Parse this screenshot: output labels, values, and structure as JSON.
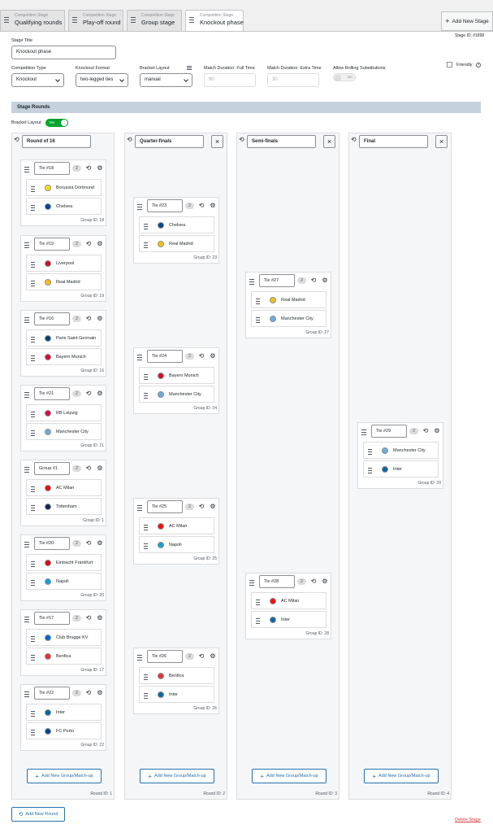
{
  "tabs": [
    {
      "sub": "Competition Stage",
      "label": "Qualifying rounds"
    },
    {
      "sub": "Competition Stage",
      "label": "Play-off round"
    },
    {
      "sub": "Competition Stage",
      "label": "Group stage"
    },
    {
      "sub": "Competition Stage",
      "label": "Knockout phase"
    }
  ],
  "add_stage_label": "Add New Stage",
  "stage_id": "Stage ID: #1898",
  "stage_title": {
    "label": "Stage Title",
    "value": "Knockout phase"
  },
  "friendly_label": "Friendly",
  "fields": {
    "competition_type": {
      "label": "Competition Type",
      "value": "Knockout"
    },
    "knockout_format": {
      "label": "Knockout Format",
      "value": "two-legged ties"
    },
    "bracket_layout": {
      "label": "Bracket Layout",
      "value": "manual"
    },
    "duration_full": {
      "label": "Match Duration: Full Time",
      "placeholder": "90"
    },
    "duration_extra": {
      "label": "Match Duration: Extra Time",
      "placeholder": "30"
    },
    "rolling_subs": {
      "label": "Allow Rolling Substitutions",
      "toggle": "No"
    }
  },
  "section_title": "Stage Rounds",
  "bracket_layout_toggle": {
    "label": "Bracket Layout",
    "toggle": "Yes"
  },
  "add_group_label": "Add New Group/Match-up",
  "add_round_label": "Add New Round",
  "delete_stage_label": "Delete Stage",
  "rounds": [
    {
      "name": "Round of 16",
      "round_id": "Round ID: 1",
      "groups": [
        {
          "tie": "Tie #18",
          "count": "2",
          "team1": "Borussia Dortmund",
          "team2": "Chelsea",
          "group_id": "Group ID: 18"
        },
        {
          "tie": "Tie #19",
          "count": "2",
          "team1": "Liverpool",
          "team2": "Real Madrid",
          "group_id": "Group ID: 19"
        },
        {
          "tie": "Tie #16",
          "count": "2",
          "team1": "Paris Saint Germain",
          "team2": "Bayern Munich",
          "group_id": "Group ID: 16"
        },
        {
          "tie": "Tie #21",
          "count": "2",
          "team1": "RB Leipzig",
          "team2": "Manchester City",
          "group_id": "Group ID: 21"
        },
        {
          "tie": "Group #1",
          "count": "2",
          "team1": "AC Milan",
          "team2": "Tottenham",
          "group_id": "Group ID: 1"
        },
        {
          "tie": "Tie #20",
          "count": "2",
          "team1": "Eintracht Frankfurt",
          "team2": "Napoli",
          "group_id": "Group ID: 20"
        },
        {
          "tie": "Tie #17",
          "count": "2",
          "team1": "Club Brugge KV",
          "team2": "Benfica",
          "group_id": "Group ID: 17"
        },
        {
          "tie": "Tie #22",
          "count": "2",
          "team1": "Inter",
          "team2": "FC Porto",
          "group_id": "Group ID: 22"
        }
      ]
    },
    {
      "name": "Quarter-finals",
      "round_id": "Round ID: 2",
      "groups": [
        {
          "tie": "Tie #23",
          "count": "2",
          "team1": "Chelsea",
          "team2": "Real Madrid",
          "group_id": "Group ID: 23"
        },
        {
          "tie": "Tie #24",
          "count": "2",
          "team1": "Bayern Munich",
          "team2": "Manchester City",
          "group_id": "Group ID: 24"
        },
        {
          "tie": "Tie #25",
          "count": "2",
          "team1": "AC Milan",
          "team2": "Napoli",
          "group_id": "Group ID: 25"
        },
        {
          "tie": "Tie #26",
          "count": "2",
          "team1": "Benfica",
          "team2": "Inter",
          "group_id": "Group ID: 26"
        }
      ]
    },
    {
      "name": "Semi-finals",
      "round_id": "Round ID: 3",
      "groups": [
        {
          "tie": "Tie #27",
          "count": "2",
          "team1": "Real Madrid",
          "team2": "Manchester City",
          "group_id": "Group ID: 27"
        },
        {
          "tie": "Tie #28",
          "count": "2",
          "team1": "AC Milan",
          "team2": "Inter",
          "group_id": "Group ID: 28"
        }
      ]
    },
    {
      "name": "Final",
      "round_id": "Round ID: 4",
      "groups": [
        {
          "tie": "Tie #29",
          "count": "2",
          "team1": "Manchester City",
          "team2": "Inter",
          "group_id": "Group ID: 29"
        }
      ]
    }
  ],
  "colors": {
    "accent": "#2271b1",
    "toggle_on": "#00a32a",
    "danger": "#d63638",
    "section_bg": "#c5d2dd"
  }
}
